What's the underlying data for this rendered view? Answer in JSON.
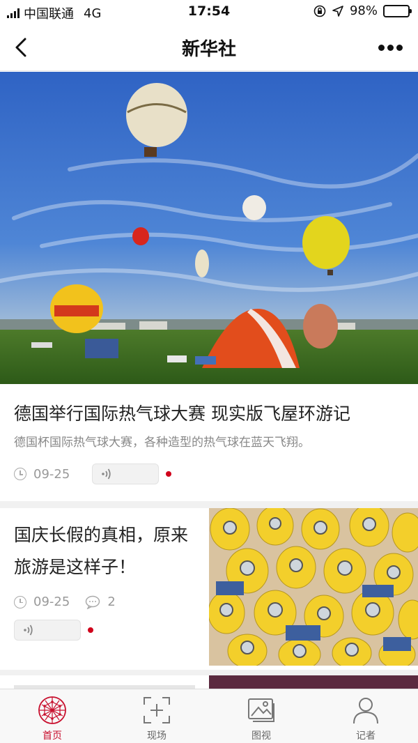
{
  "status_bar": {
    "carrier": "中国联通",
    "network": "4G",
    "time": "17:54",
    "battery_percent": "98%",
    "battery_level": 0.98
  },
  "nav": {
    "title": "新华社"
  },
  "articles": [
    {
      "title": "德国举行国际热气球大赛 现实版飞屋环游记",
      "summary": "德国杯国际热气球大赛，各种造型的热气球在蓝天飞翔。",
      "date": "09-25",
      "image": "hot-air-balloons-photo"
    },
    {
      "title": "国庆长假的真相，原来旅游是这样子！",
      "date": "09-25",
      "comments": "2",
      "image": "minions-crowd-photo"
    }
  ],
  "tabs": [
    {
      "label": "首页",
      "icon": "globe-network-icon",
      "active": true
    },
    {
      "label": "现场",
      "icon": "scan-add-icon",
      "active": false
    },
    {
      "label": "图视",
      "icon": "gallery-image-icon",
      "active": false
    },
    {
      "label": "记者",
      "icon": "person-icon",
      "active": false
    }
  ],
  "colors": {
    "accent": "#c8102e",
    "recording_dot": "#d0021b"
  }
}
